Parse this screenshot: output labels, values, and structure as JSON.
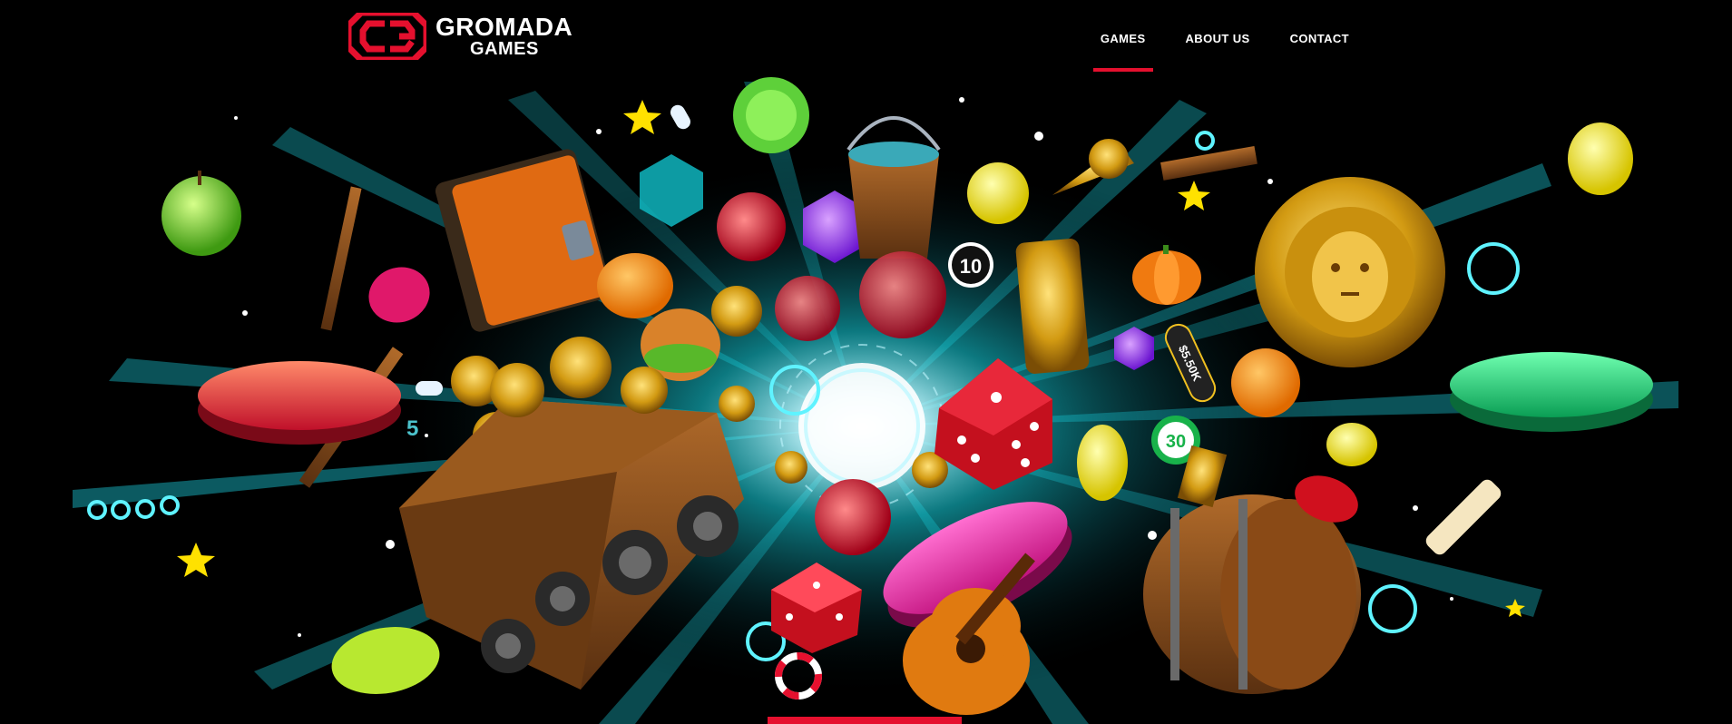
{
  "brand": {
    "name_line1": "GROMADA",
    "name_line2": "GAMES",
    "accent_color": "#e5102e"
  },
  "nav": {
    "items": [
      {
        "label": "GAMES",
        "active": true
      },
      {
        "label": "ABOUT US",
        "active": false
      },
      {
        "label": "CONTACT",
        "active": false
      }
    ]
  },
  "hero": {
    "dice_number_label": "10",
    "chip_label": "30",
    "price_tag": "$5.50K",
    "small_number": "5"
  },
  "icons": {
    "logo": "gromada-logo-icon"
  }
}
